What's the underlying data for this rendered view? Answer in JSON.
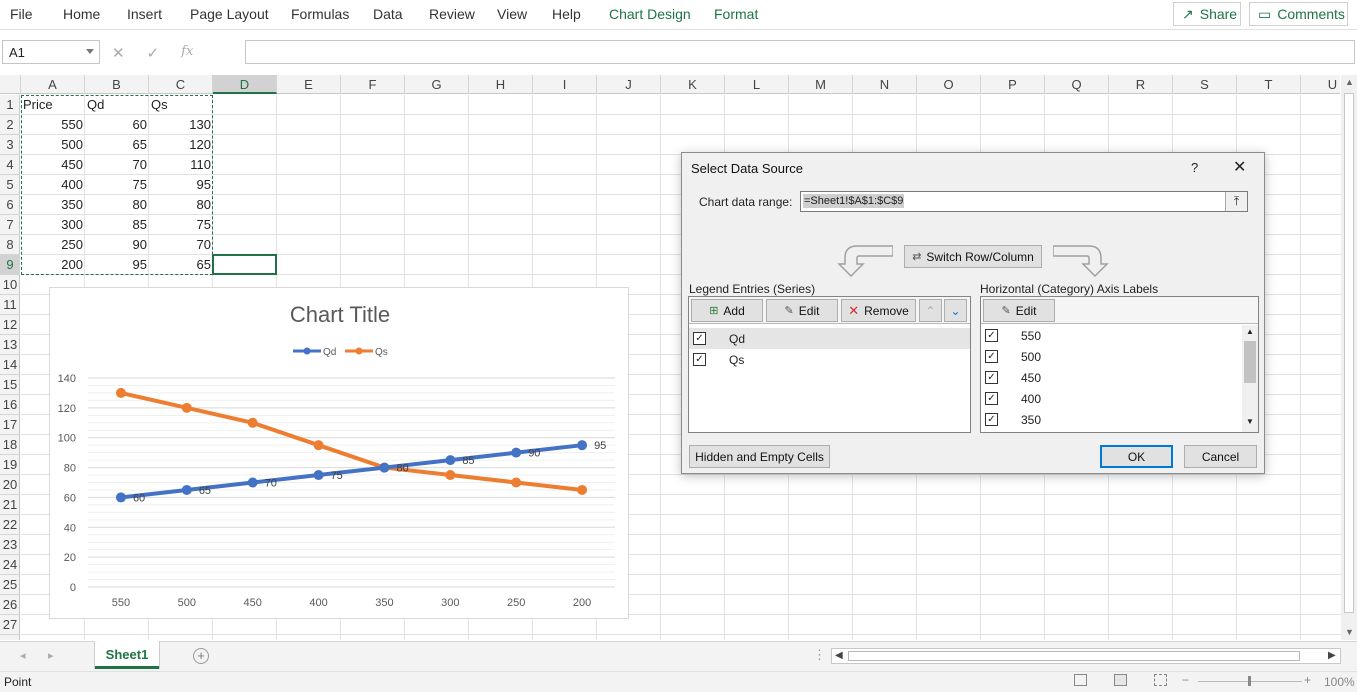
{
  "ribbon": {
    "tabs": [
      "File",
      "Home",
      "Insert",
      "Page Layout",
      "Formulas",
      "Data",
      "Review",
      "View",
      "Help",
      "Chart Design",
      "Format"
    ],
    "share_label": "Share",
    "comments_label": "Comments"
  },
  "formula_bar": {
    "name_box": "A1",
    "fx_label": "fx",
    "value": ""
  },
  "columns": [
    "A",
    "B",
    "C",
    "D",
    "E",
    "F",
    "G",
    "H",
    "I",
    "J",
    "K",
    "L",
    "M",
    "N",
    "O",
    "P",
    "Q",
    "R",
    "S",
    "T",
    "U"
  ],
  "rows": [
    "1",
    "2",
    "3",
    "4",
    "5",
    "6",
    "7",
    "8",
    "9",
    "10",
    "11",
    "12",
    "13",
    "14",
    "15",
    "16",
    "17",
    "18",
    "19",
    "20",
    "21",
    "22",
    "23",
    "24",
    "25",
    "26",
    "27"
  ],
  "sheet": {
    "headers": [
      "Price",
      "Qd",
      "Qs"
    ],
    "data": [
      [
        "550",
        "60",
        "130"
      ],
      [
        "500",
        "65",
        "120"
      ],
      [
        "450",
        "70",
        "110"
      ],
      [
        "400",
        "75",
        "95"
      ],
      [
        "350",
        "80",
        "80"
      ],
      [
        "300",
        "85",
        "75"
      ],
      [
        "250",
        "90",
        "70"
      ],
      [
        "200",
        "95",
        "65"
      ]
    ]
  },
  "chart_data": {
    "type": "line",
    "title": "Chart Title",
    "categories": [
      "550",
      "500",
      "450",
      "400",
      "350",
      "300",
      "250",
      "200"
    ],
    "series": [
      {
        "name": "Qd",
        "color": "#4472c4",
        "values": [
          60,
          65,
          70,
          75,
          80,
          85,
          90,
          95
        ]
      },
      {
        "name": "Qs",
        "color": "#ed7d31",
        "values": [
          130,
          120,
          110,
          95,
          80,
          75,
          70,
          65
        ]
      }
    ],
    "ylim": [
      0,
      140
    ],
    "yticks": [
      "0",
      "20",
      "40",
      "60",
      "80",
      "100",
      "120",
      "140"
    ],
    "data_labels_series": "Qd",
    "legend": "top",
    "grid": true
  },
  "dialog": {
    "title": "Select Data Source",
    "help": "?",
    "range_label": "Chart data range:",
    "range_value": "=Sheet1!$A$1:$C$9",
    "switch_label": "Switch Row/Column",
    "legend_label": "Legend Entries (Series)",
    "add_label": "Add",
    "edit_label": "Edit",
    "remove_label": "Remove",
    "series_items": [
      "Qd",
      "Qs"
    ],
    "axis_label": "Horizontal (Category) Axis Labels",
    "axis_edit_label": "Edit",
    "axis_items": [
      "550",
      "500",
      "450",
      "400",
      "350"
    ],
    "hidden_label": "Hidden and Empty Cells",
    "ok_label": "OK",
    "cancel_label": "Cancel"
  },
  "sheet_tab": "Sheet1",
  "status": {
    "mode": "Point",
    "zoom": "100%"
  }
}
